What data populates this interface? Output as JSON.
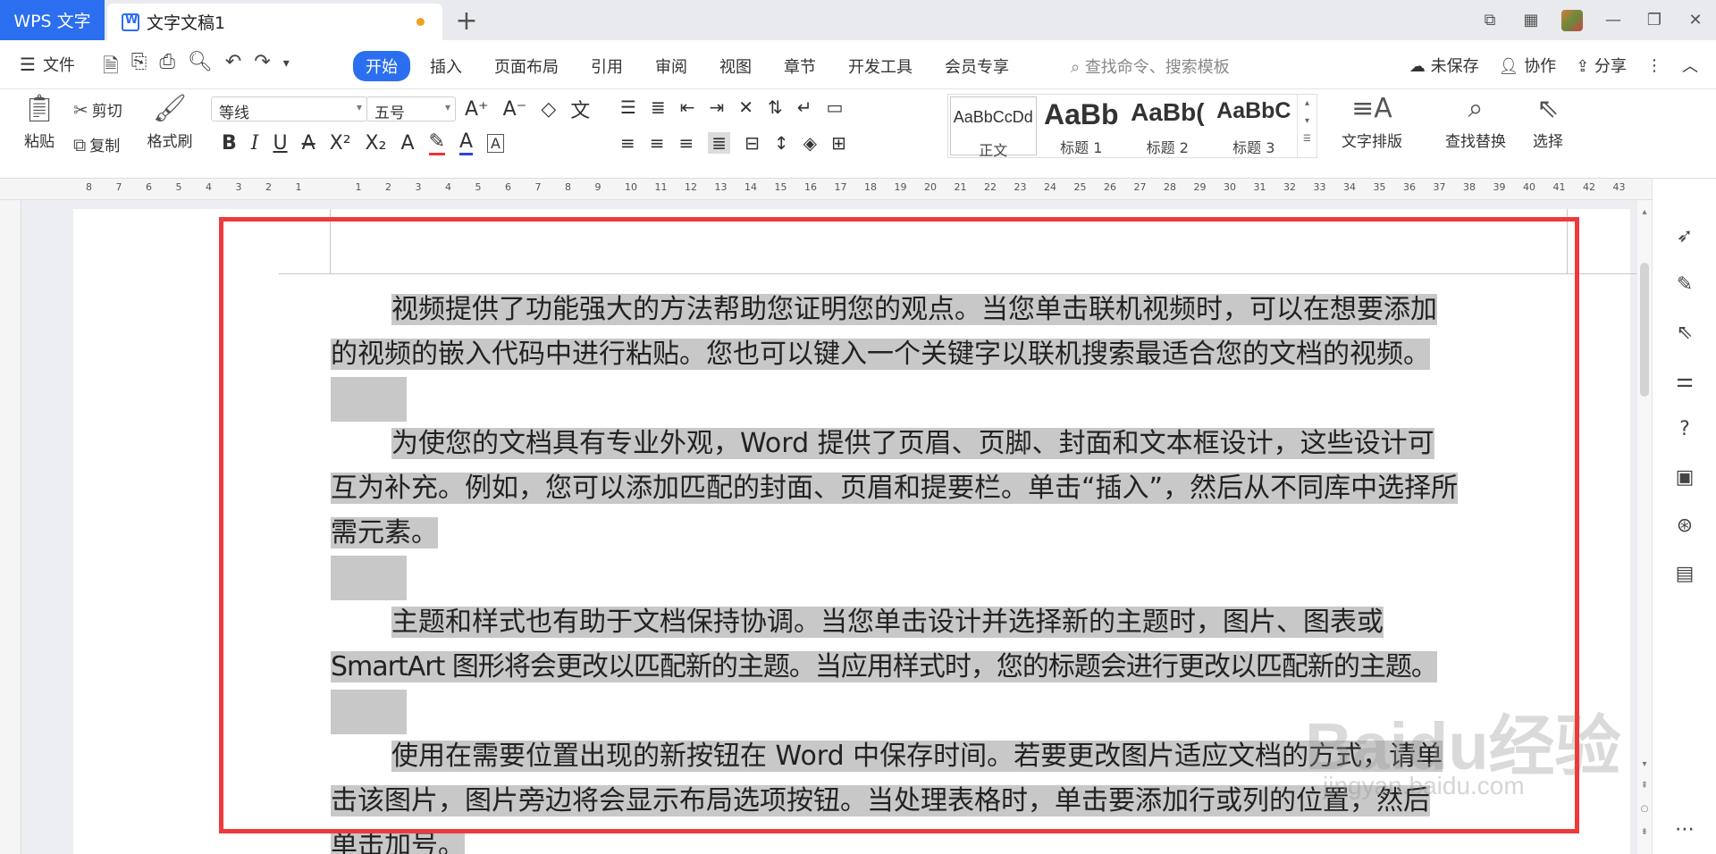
{
  "titlebar": {
    "app_tab": "WPS 文字",
    "doc_tab": "文字文稿1",
    "new_tab_icon": "+"
  },
  "menubar": {
    "file_label": "文件",
    "menus": [
      "开始",
      "插入",
      "页面布局",
      "引用",
      "审阅",
      "视图",
      "章节",
      "开发工具",
      "会员专享"
    ],
    "active_menu": "开始",
    "search_placeholder": "查找命令、搜索模板",
    "unsaved": "未保存",
    "collab": "协作",
    "share": "分享"
  },
  "ribbon": {
    "paste": "粘贴",
    "cut": "剪切",
    "copy": "复制",
    "format_painter": "格式刷",
    "font_name": "等线",
    "font_size": "五号",
    "styles": [
      {
        "preview": "AaBbCcDd",
        "label": "正文"
      },
      {
        "preview": "AaBb",
        "label": "标题 1"
      },
      {
        "preview": "AaBb(",
        "label": "标题 2"
      },
      {
        "preview": "AaBbC",
        "label": "标题 3"
      }
    ],
    "text_layout": "文字排版",
    "find_replace": "查找替换",
    "select": "选择"
  },
  "ruler_ticks": [
    "8",
    "7",
    "6",
    "5",
    "4",
    "3",
    "2",
    "1",
    "",
    "1",
    "2",
    "3",
    "4",
    "5",
    "6",
    "7",
    "8",
    "9",
    "10",
    "11",
    "12",
    "13",
    "14",
    "15",
    "16",
    "17",
    "18",
    "19",
    "20",
    "21",
    "22",
    "23",
    "24",
    "25",
    "26",
    "27",
    "28",
    "29",
    "30",
    "31",
    "32",
    "33",
    "34",
    "35",
    "36",
    "37",
    "38",
    "39",
    "40",
    "41",
    "42",
    "43"
  ],
  "document": {
    "paragraphs": [
      [
        "视频提供了功能强大的方法帮助您证明您的观点。当您单击联机视频时，可以在想要添加",
        "的视频的嵌入代码中进行粘贴。您也可以键入一个关键字以联机搜索最适合您的文档的视频。"
      ],
      [
        "为使您的文档具有专业外观，Word 提供了页眉、页脚、封面和文本框设计，这些设计可",
        "互为补充。例如，您可以添加匹配的封面、页眉和提要栏。单击“插入”，然后从不同库中选择所",
        "需元素。"
      ],
      [
        "主题和样式也有助于文档保持协调。当您单击设计并选择新的主题时，图片、图表或",
        "SmartArt 图形将会更改以匹配新的主题。当应用样式时，您的标题会进行更改以匹配新的主题。"
      ],
      [
        "使用在需要位置出现的新按钮在 Word 中保存时间。若要更改图片适应文档的方式，请单",
        "击该图片，图片旁边将会显示布局选项按钮。当处理表格时，单击要添加行或列的位置，然后",
        "单击加号。"
      ]
    ]
  },
  "watermark": {
    "main": "Baidu经验",
    "sub": "jingyan.baidu.com"
  },
  "colors": {
    "accent": "#2b6ff0",
    "highlight": "#c8c8c8",
    "annotation": "#ee3a3a"
  }
}
